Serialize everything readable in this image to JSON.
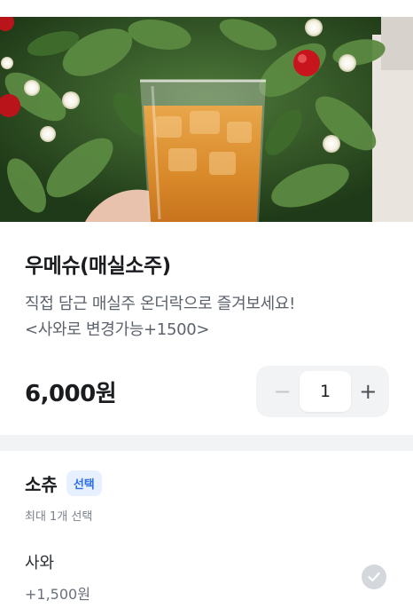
{
  "product": {
    "name": "우메슈(매실소주)",
    "description_line1": "직접 담근 매실주 온더락으로 즐겨보세요!",
    "description_line2": "<사와로 변경가능+1500>",
    "price": "6,000원",
    "quantity": "1",
    "image_icon": "drink-photo"
  },
  "stepper": {
    "minus_glyph": "−",
    "plus_glyph": "+"
  },
  "option_group": {
    "title": "소츄",
    "badge": "선택",
    "subtitle": "최대 1개 선택",
    "items": [
      {
        "name": "사와",
        "price": "+1,500원"
      }
    ]
  },
  "colors": {
    "badge_bg": "#e6f0ff",
    "badge_text": "#2f6fe6",
    "stepper_bg": "#f2f3f5",
    "check_bg": "#d4d7dc"
  }
}
